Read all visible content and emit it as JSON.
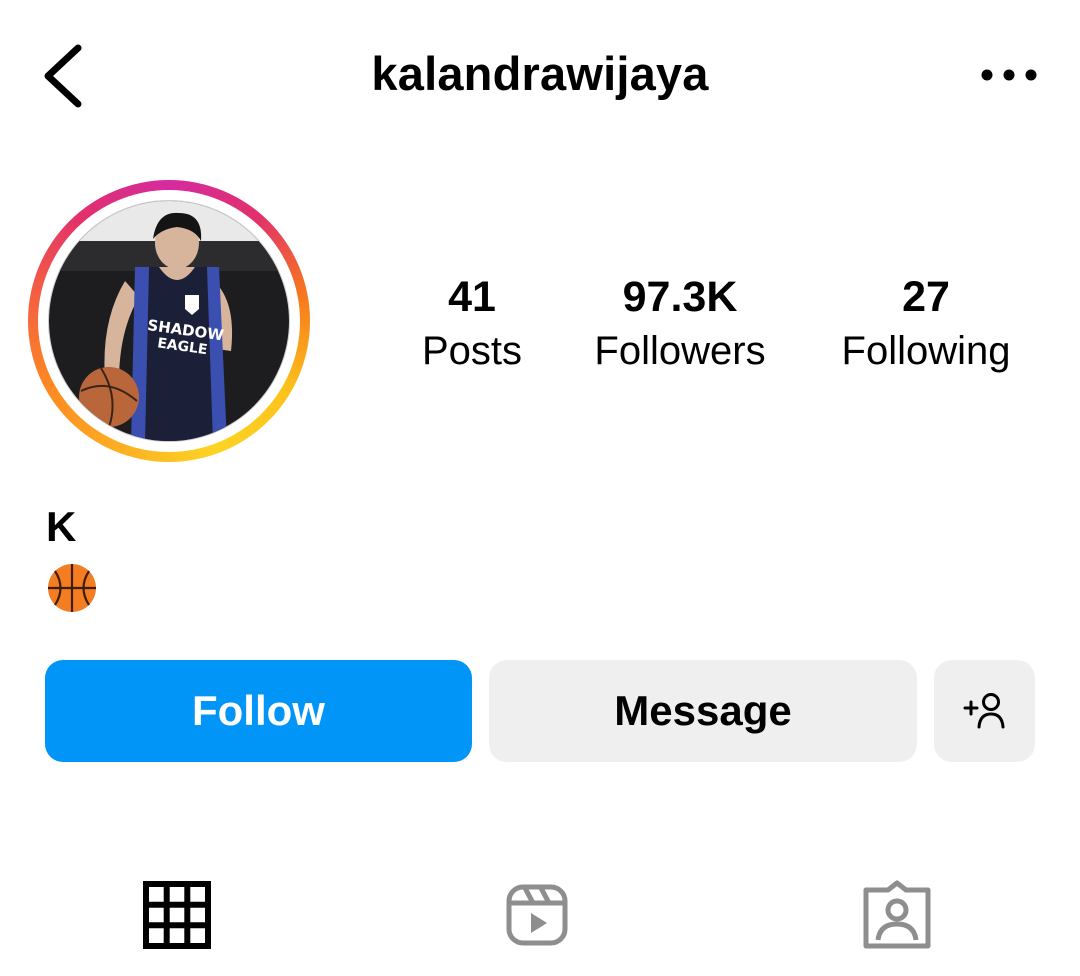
{
  "header": {
    "back_icon": "chevron-left-icon",
    "username": "kalandrawijaya",
    "more_icon": "more-horizontal-icon"
  },
  "profile": {
    "avatar_description_icon": "profile-photo",
    "name": "K",
    "bio_emoji": "🏀",
    "stats": {
      "posts": {
        "value": "41",
        "label": "Posts"
      },
      "followers": {
        "value": "97.3K",
        "label": "Followers"
      },
      "following": {
        "value": "27",
        "label": "Following"
      }
    }
  },
  "actions": {
    "follow_label": "Follow",
    "message_label": "Message",
    "suggest_icon": "add-person-icon"
  },
  "tabs": [
    {
      "icon": "grid-icon",
      "active": true
    },
    {
      "icon": "reels-icon",
      "active": false
    },
    {
      "icon": "tagged-icon",
      "active": false
    }
  ],
  "colors": {
    "follow_blue": "#0095f6",
    "button_gray": "#efefef",
    "inactive_icon": "#8e8e8e",
    "story_ring_start": "#fdd423",
    "story_ring_end": "#d62a9f"
  }
}
